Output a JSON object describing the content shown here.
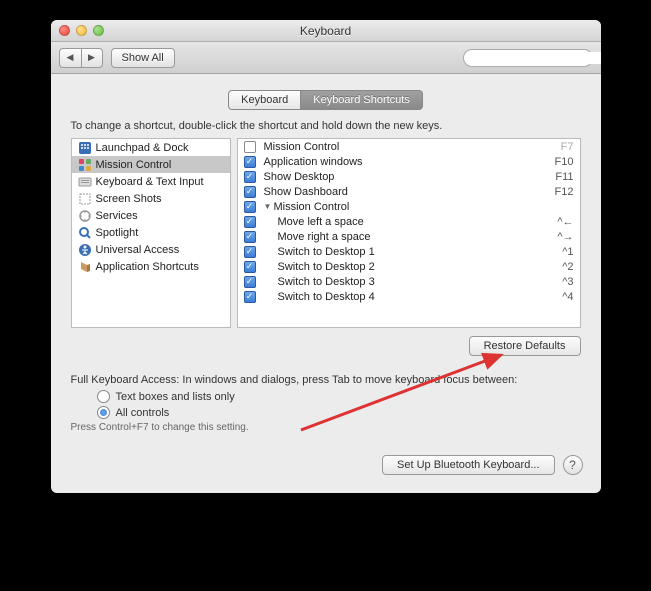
{
  "window": {
    "title": "Keyboard"
  },
  "toolbar": {
    "back": "◀",
    "forward": "▶",
    "show_all": "Show All",
    "search_placeholder": ""
  },
  "tabs": {
    "keyboard": "Keyboard",
    "shortcuts": "Keyboard Shortcuts"
  },
  "instruction": "To change a shortcut, double-click the shortcut and hold down the new keys.",
  "sidebar": {
    "items": [
      {
        "label": "Launchpad & Dock",
        "icon": "launchpad",
        "selected": false
      },
      {
        "label": "Mission Control",
        "icon": "mission",
        "selected": true
      },
      {
        "label": "Keyboard & Text Input",
        "icon": "keyboard",
        "selected": false
      },
      {
        "label": "Screen Shots",
        "icon": "screenshot",
        "selected": false
      },
      {
        "label": "Services",
        "icon": "services",
        "selected": false
      },
      {
        "label": "Spotlight",
        "icon": "spotlight",
        "selected": false
      },
      {
        "label": "Universal Access",
        "icon": "access",
        "selected": false
      },
      {
        "label": "Application Shortcuts",
        "icon": "apps",
        "selected": false
      }
    ]
  },
  "shortcuts": {
    "rows": [
      {
        "checked": false,
        "indent": 0,
        "disclosure": "",
        "label": "Mission Control",
        "key": "F7",
        "dim": true
      },
      {
        "checked": true,
        "indent": 0,
        "disclosure": "",
        "label": "Application windows",
        "key": "F10",
        "dim": false
      },
      {
        "checked": true,
        "indent": 0,
        "disclosure": "",
        "label": "Show Desktop",
        "key": "F11",
        "dim": false
      },
      {
        "checked": true,
        "indent": 0,
        "disclosure": "",
        "label": "Show Dashboard",
        "key": "F12",
        "dim": false
      },
      {
        "checked": true,
        "indent": 0,
        "disclosure": "▼",
        "label": "Mission Control",
        "key": "",
        "dim": false
      },
      {
        "checked": true,
        "indent": 1,
        "disclosure": "",
        "label": "Move left a space",
        "key": "^←",
        "dim": false
      },
      {
        "checked": true,
        "indent": 1,
        "disclosure": "",
        "label": "Move right a space",
        "key": "^→",
        "dim": false
      },
      {
        "checked": true,
        "indent": 1,
        "disclosure": "",
        "label": "Switch to Desktop 1",
        "key": "^1",
        "dim": false
      },
      {
        "checked": true,
        "indent": 1,
        "disclosure": "",
        "label": "Switch to Desktop 2",
        "key": "^2",
        "dim": false
      },
      {
        "checked": true,
        "indent": 1,
        "disclosure": "",
        "label": "Switch to Desktop 3",
        "key": "^3",
        "dim": false
      },
      {
        "checked": true,
        "indent": 1,
        "disclosure": "",
        "label": "Switch to Desktop 4",
        "key": "^4",
        "dim": false
      }
    ]
  },
  "restore": "Restore Defaults",
  "fka": {
    "text": "Full Keyboard Access: In windows and dialogs, press Tab to move keyboard focus between:",
    "opt1": "Text boxes and lists only",
    "opt2": "All controls",
    "selected": "opt2",
    "hint": "Press Control+F7 to change this setting."
  },
  "footer": {
    "bluetooth": "Set Up Bluetooth Keyboard...",
    "help": "?"
  }
}
